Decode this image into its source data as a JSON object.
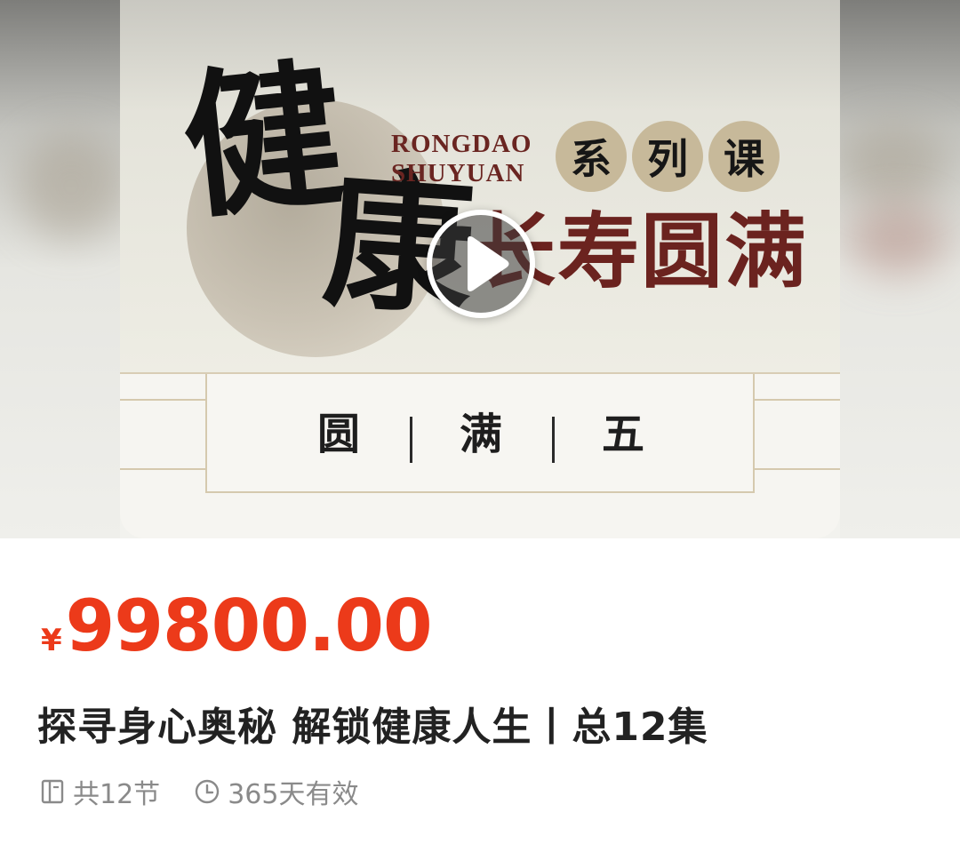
{
  "banner": {
    "calligraphy": [
      "健",
      "康"
    ],
    "brand_line1": "RONGDAO",
    "brand_line2": "SHUYUAN",
    "series_badges": [
      "系",
      "列",
      "课"
    ],
    "subtitle": "长寿圆满",
    "plaque_chars": [
      "圆",
      "满",
      "五"
    ],
    "play_icon": "play-icon"
  },
  "product": {
    "currency": "¥",
    "price": "99800.00",
    "title": "探寻身心奥秘 解锁健康人生丨总12集",
    "lessons": "共12节",
    "lessons_icon": "book-icon",
    "validity": "365天有效",
    "validity_icon": "clock-icon"
  },
  "colors": {
    "price": "#ec3a1a",
    "brand": "#6a2521",
    "meta": "#8a8a8a"
  }
}
